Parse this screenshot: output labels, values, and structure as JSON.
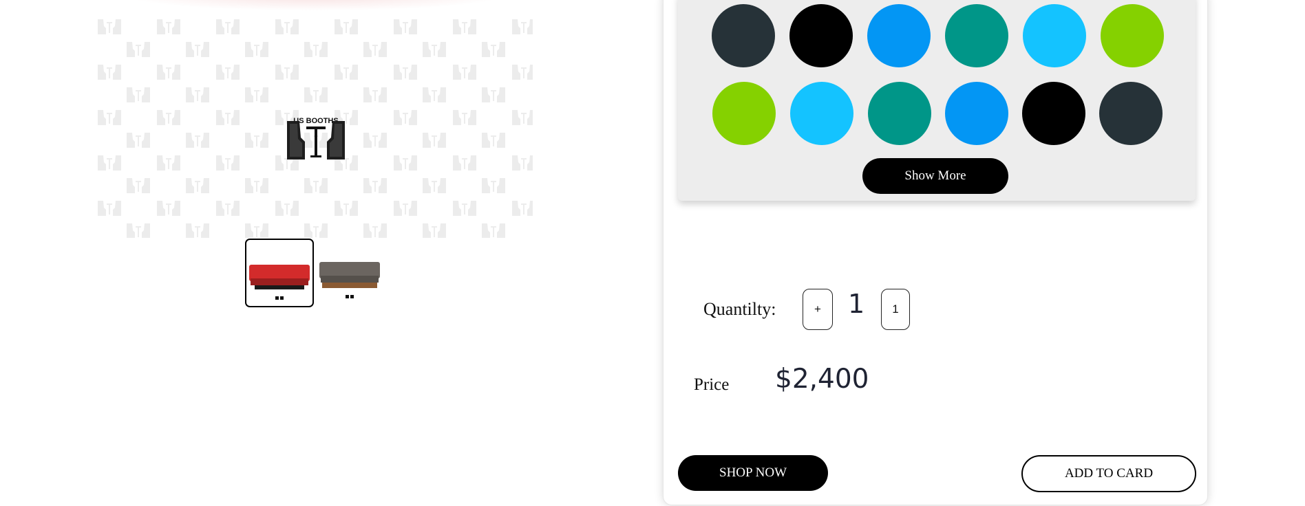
{
  "gallery": {
    "logo_text": "US BOOTHS",
    "thumbnails": [
      {
        "alt": "Red booth",
        "color": "#d32b2b",
        "active": true
      },
      {
        "alt": "Gray booth",
        "color": "#6b6560",
        "active": false
      }
    ]
  },
  "swatches": {
    "colors": [
      "#263238",
      "#000000",
      "#0396f4",
      "#009688",
      "#14c3ff",
      "#85d100",
      "#85d100",
      "#14c3ff",
      "#009688",
      "#0396f4",
      "#000000",
      "#263238"
    ],
    "show_more_label": "Show More"
  },
  "quantity": {
    "label": "Quantilty:",
    "increment_label": "+",
    "value": "1",
    "decrement_label": "1"
  },
  "price": {
    "label": "Price",
    "value": "$2,400"
  },
  "actions": {
    "shop_now_label": "SHOP NOW",
    "add_to_card_label": "ADD TO CARD"
  }
}
